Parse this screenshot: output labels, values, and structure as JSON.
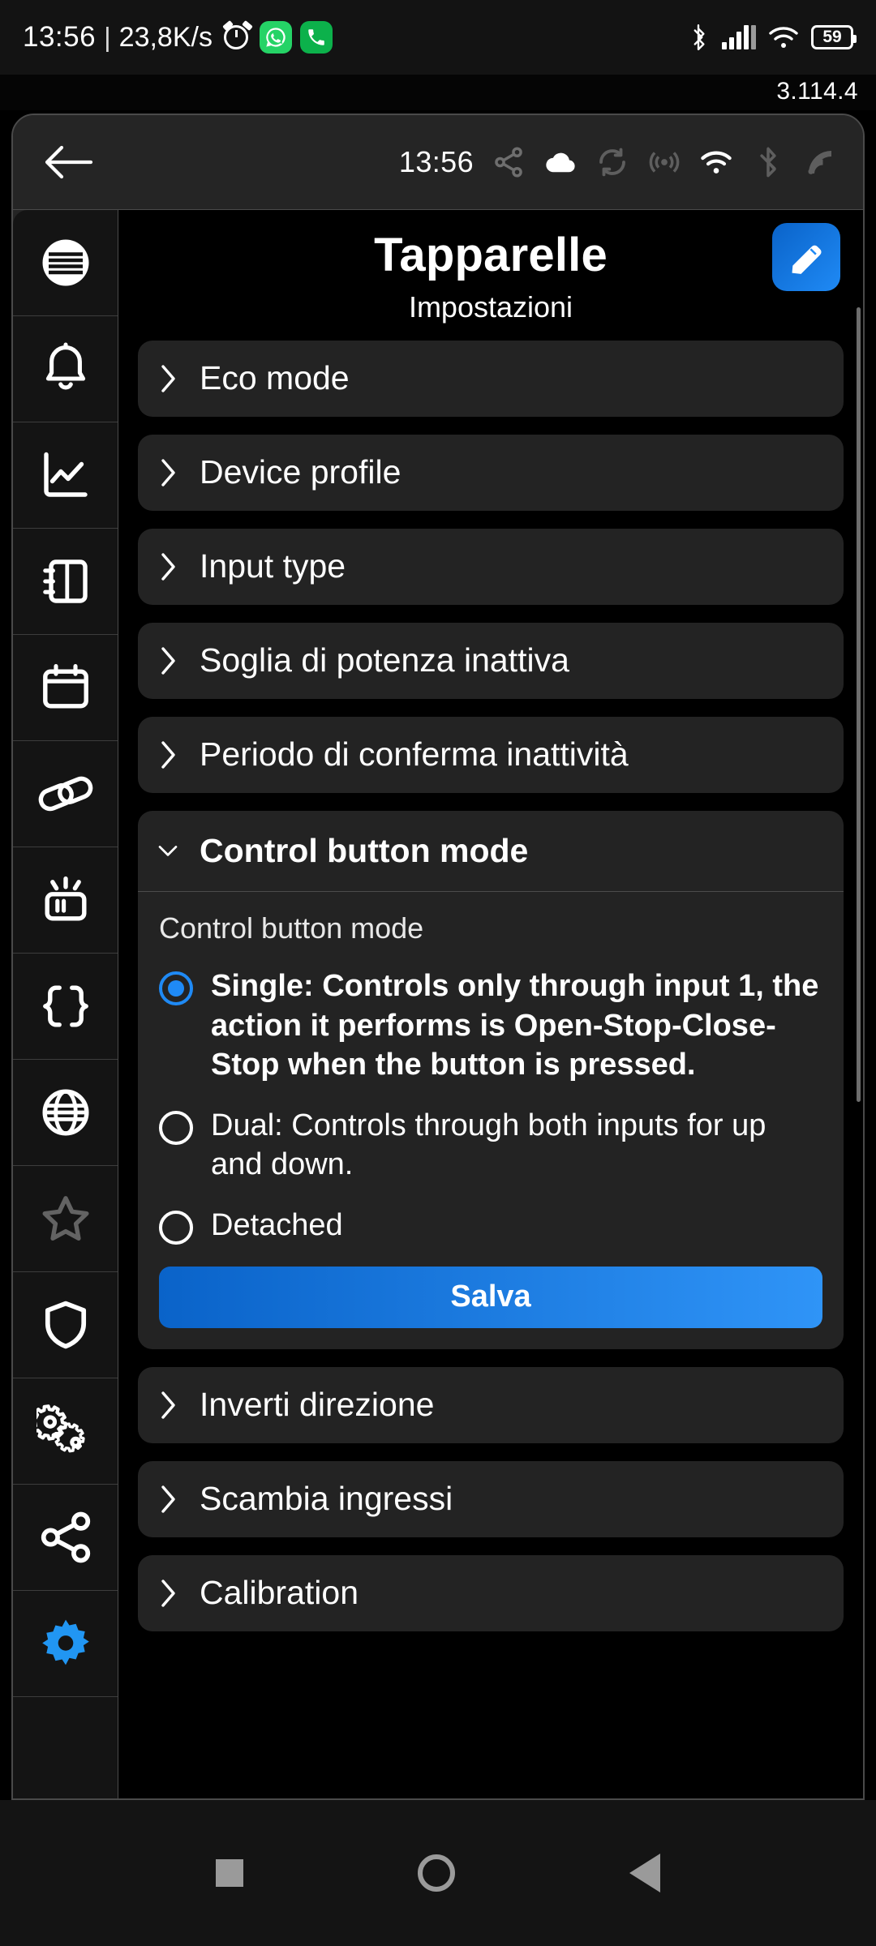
{
  "status_bar": {
    "time": "13:56",
    "separator": "|",
    "net_speed": "23,8K/s",
    "icons_left": [
      "alarm-icon",
      "whatsapp-icon",
      "phone-icon"
    ],
    "icons_right": [
      "bluetooth-icon",
      "cellular-signal-icon",
      "wifi-icon"
    ],
    "battery_percent": "59"
  },
  "wallpaper": {
    "version": "3.114.4"
  },
  "app_bar": {
    "back_label": "back-arrow",
    "time": "13:56",
    "icons": [
      "share-nodes-icon",
      "cloud-icon",
      "sync-icon",
      "broadcast-icon",
      "wifi-icon",
      "bluetooth-icon",
      "signal-waves-icon"
    ]
  },
  "sidebar": {
    "items": [
      {
        "name": "sidebar-item-overview",
        "icon": "list-circle-icon",
        "active": false
      },
      {
        "name": "sidebar-item-notifications",
        "icon": "bell-icon",
        "active": false
      },
      {
        "name": "sidebar-item-statistics",
        "icon": "line-chart-icon",
        "active": false
      },
      {
        "name": "sidebar-item-notebook",
        "icon": "notebook-icon",
        "active": false
      },
      {
        "name": "sidebar-item-schedule",
        "icon": "calendar-icon",
        "active": false
      },
      {
        "name": "sidebar-item-links",
        "icon": "chain-link-icon",
        "active": false
      },
      {
        "name": "sidebar-item-device",
        "icon": "device-rays-icon",
        "active": false
      },
      {
        "name": "sidebar-item-json",
        "icon": "curly-braces-icon",
        "active": false
      },
      {
        "name": "sidebar-item-network",
        "icon": "globe-icon",
        "active": false
      },
      {
        "name": "sidebar-item-favorites",
        "icon": "star-icon",
        "active": false,
        "dimmed": true
      },
      {
        "name": "sidebar-item-security",
        "icon": "shield-icon",
        "active": false
      },
      {
        "name": "sidebar-item-advanced",
        "icon": "double-gears-icon",
        "active": false
      },
      {
        "name": "sidebar-item-sharing",
        "icon": "share-nodes-icon",
        "active": false
      },
      {
        "name": "sidebar-item-settings",
        "icon": "gear-icon",
        "active": true
      }
    ]
  },
  "main": {
    "title": "Tapparelle",
    "subtitle": "Impostazioni",
    "edit_button": "edit-pencil-icon",
    "rows_top": [
      {
        "label": "Eco mode"
      },
      {
        "label": "Device profile"
      },
      {
        "label": "Input type"
      },
      {
        "label": "Soglia di potenza inattiva"
      },
      {
        "label": "Periodo di conferma inattività"
      }
    ],
    "expanded_card": {
      "header": "Control button mode",
      "field_label": "Control button mode",
      "options": [
        {
          "label": "Single: Controls only through input 1, the action it performs is Open-Stop-Close-Stop when the button is pressed.",
          "selected": true
        },
        {
          "label": "Dual: Controls through both inputs for up and down.",
          "selected": false
        },
        {
          "label": "Detached",
          "selected": false
        }
      ],
      "save_label": "Salva"
    },
    "rows_bottom": [
      {
        "label": "Inverti direzione"
      },
      {
        "label": "Scambia ingressi"
      },
      {
        "label": "Calibration"
      }
    ]
  },
  "nav_bar": {
    "buttons": [
      "recents-square-button",
      "home-circle-button",
      "back-triangle-button"
    ]
  },
  "colors": {
    "accent_blue": "#1f8af5",
    "card_bg": "#232323",
    "app_bg": "#252525",
    "content_bg": "#000000",
    "sidebar_bg": "#141414"
  }
}
